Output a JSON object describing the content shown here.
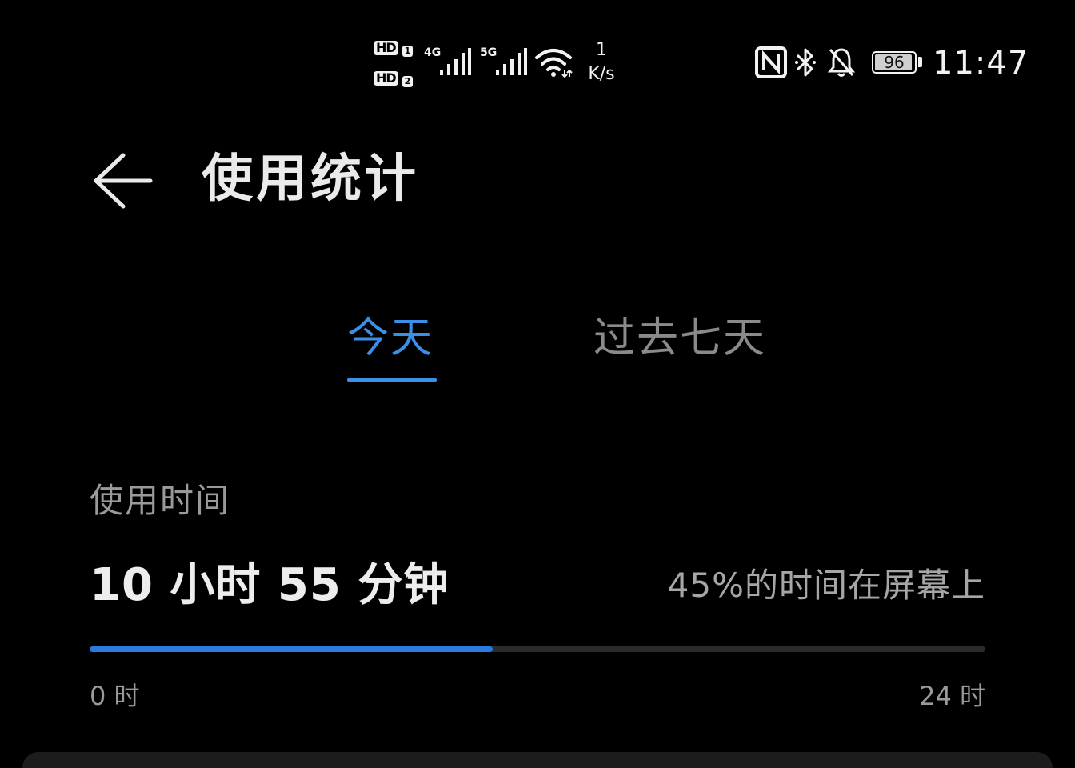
{
  "status_bar": {
    "hd1": "HD",
    "hd1_sub": "1",
    "hd2": "HD",
    "hd2_sub": "2",
    "net1": "4G",
    "net2": "5G",
    "speed_value": "1",
    "speed_unit": "K/s",
    "battery_level": "96",
    "battery_fraction": 0.96,
    "time": "11:47",
    "icons": [
      "signal-icon",
      "wifi-icon",
      "nfc-icon",
      "bluetooth-icon",
      "bell-off-icon",
      "battery-icon"
    ]
  },
  "header": {
    "title": "使用统计",
    "back_icon": "arrow-left-icon"
  },
  "tabs": [
    {
      "label": "今天",
      "active": true
    },
    {
      "label": "过去七天",
      "active": false
    }
  ],
  "usage": {
    "label": "使用时间",
    "value": "10 小时 55 分钟",
    "percent_text": "45%的时间在屏幕上",
    "progress_fraction": 0.45,
    "axis_start": "0 时",
    "axis_end": "24 时"
  },
  "colors": {
    "accent": "#3b8fe6",
    "progress": "#2a7be0",
    "background": "#000000",
    "inactive_tab": "#8a8a8a"
  }
}
